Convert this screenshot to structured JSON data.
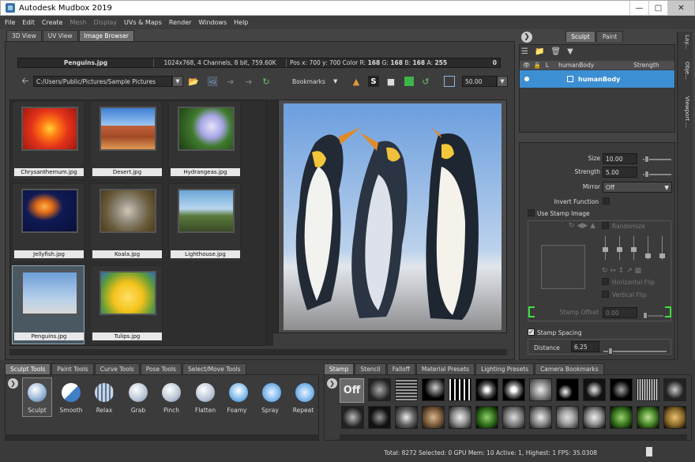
{
  "window": {
    "title": "Autodesk Mudbox 2019",
    "controls": [
      "minimize",
      "maximize",
      "close"
    ]
  },
  "menu": [
    {
      "label": "File",
      "enabled": true
    },
    {
      "label": "Edit",
      "enabled": true
    },
    {
      "label": "Create",
      "enabled": true
    },
    {
      "label": "Mesh",
      "enabled": false
    },
    {
      "label": "Display",
      "enabled": false
    },
    {
      "label": "UVs & Maps",
      "enabled": true
    },
    {
      "label": "Render",
      "enabled": true
    },
    {
      "label": "Windows",
      "enabled": true
    },
    {
      "label": "Help",
      "enabled": true
    }
  ],
  "view_tabs": [
    {
      "label": "3D View",
      "active": false
    },
    {
      "label": "UV View",
      "active": false
    },
    {
      "label": "Image Browser",
      "active": true
    }
  ],
  "info": {
    "filename": "Penguins.jpg",
    "details": "1024x768, 4 Channels, 8 bit, 759.60K",
    "pos_prefix": "Pos x: 700 y: 700 Color R:",
    "r": "168",
    "g_label": "G:",
    "g": "168",
    "b_label": "B:",
    "b": "168",
    "a_label": "A:",
    "a": "255",
    "extra": "0"
  },
  "path": {
    "value": "C:/Users/Public/Pictures/Sample Pictures"
  },
  "bookmarks": {
    "label": "Bookmarks"
  },
  "zoom": {
    "value": "50.00"
  },
  "thumbnails": [
    {
      "name": "Chrysanthemum.jpg",
      "selected": false
    },
    {
      "name": "Desert.jpg",
      "selected": false
    },
    {
      "name": "Hydrangeas.jpg",
      "selected": false
    },
    {
      "name": "Jellyfish.jpg",
      "selected": false
    },
    {
      "name": "Koala.jpg",
      "selected": false
    },
    {
      "name": "Lighthouse.jpg",
      "selected": false
    },
    {
      "name": "Penguins.jpg",
      "selected": true
    },
    {
      "name": "Tulips.jpg",
      "selected": false
    }
  ],
  "right_tabs": [
    {
      "label": "Sculpt",
      "active": true
    },
    {
      "label": "Paint",
      "active": false
    }
  ],
  "side_tabs": [
    "Lay...",
    "Obje...",
    "Viewport ..."
  ],
  "layers": {
    "header_label": "L",
    "header_name": "humanBody",
    "header_strength": "Strength",
    "selected_row": "humanBody"
  },
  "props": {
    "size_label": "Size",
    "size_value": "10.00",
    "size_fraction": 0.05,
    "strength_label": "Strength",
    "strength_value": "5.00",
    "strength_fraction": 0.05,
    "mirror_label": "Mirror",
    "mirror_value": "Off",
    "invert_label": "Invert Function",
    "stamp_image_label": "Use Stamp Image",
    "randomize_label": "Randomize",
    "hflip_label": "Horizontal Flip",
    "vflip_label": "Vertical Flip",
    "stamp_offset_label": "Stamp Offset",
    "stamp_offset_value": "0.00",
    "stamp_spacing_label": "Stamp Spacing",
    "stamp_spacing_checked": true,
    "distance_label": "Distance",
    "distance_value": "6.25",
    "distance_fraction": 0.08
  },
  "tool_tabs": [
    {
      "label": "Sculpt Tools",
      "active": true
    },
    {
      "label": "Paint Tools",
      "active": false
    },
    {
      "label": "Curve Tools",
      "active": false
    },
    {
      "label": "Pose Tools",
      "active": false
    },
    {
      "label": "Select/Move Tools",
      "active": false
    }
  ],
  "tools": [
    {
      "label": "Sculpt",
      "icon": "sculpt-icon",
      "selected": true
    },
    {
      "label": "Smooth",
      "icon": "smooth-icon",
      "selected": false
    },
    {
      "label": "Relax",
      "icon": "relax-icon",
      "selected": false
    },
    {
      "label": "Grab",
      "icon": "grab-icon",
      "selected": false
    },
    {
      "label": "Pinch",
      "icon": "pinch-icon",
      "selected": false
    },
    {
      "label": "Flatten",
      "icon": "flatten-icon",
      "selected": false
    },
    {
      "label": "Foamy",
      "icon": "foamy-icon",
      "selected": false
    },
    {
      "label": "Spray",
      "icon": "spray-icon",
      "selected": false
    },
    {
      "label": "Repeat",
      "icon": "repeat-icon",
      "selected": false
    }
  ],
  "stamp_tabs": [
    {
      "label": "Stamp",
      "active": true
    },
    {
      "label": "Stencil",
      "active": false
    },
    {
      "label": "Falloff",
      "active": false
    },
    {
      "label": "Material Presets",
      "active": false
    },
    {
      "label": "Lighting Presets",
      "active": false
    },
    {
      "label": "Camera Bookmarks",
      "active": false
    }
  ],
  "stamp_off_label": "Off",
  "status": "Total: 8272  Selected: 0 GPU Mem: 10  Active: 1, Highest: 1  FPS: 35.0308",
  "colors": {
    "accent": "#3a8fd6",
    "selected_layer": "#3d8fd4",
    "green_icon": "#3cb54a"
  }
}
